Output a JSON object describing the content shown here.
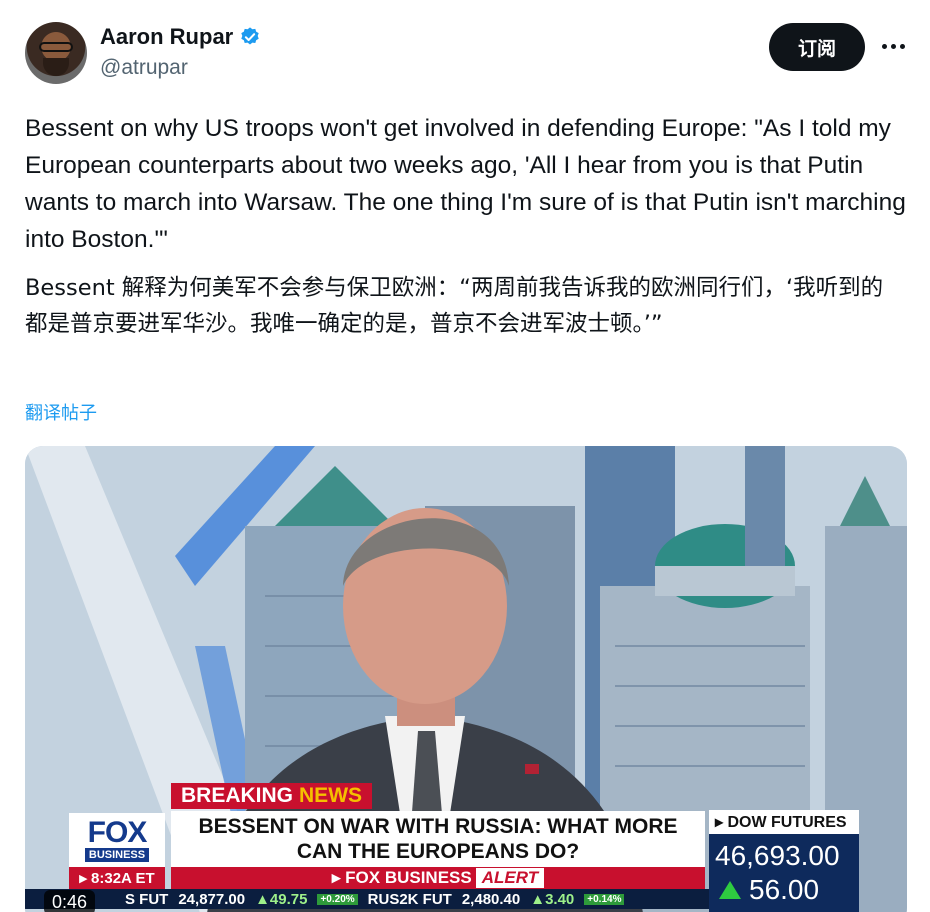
{
  "author": {
    "display_name": "Aaron Rupar",
    "handle": "@atrupar"
  },
  "header": {
    "subscribe_label": "订阅",
    "more_icon": "more-horizontal-icon"
  },
  "tweet": {
    "text_en": "Bessent on why US troops won't get involved in defending Europe: \"As I told my European counterparts about two weeks ago, 'All I hear from you is that Putin wants to march into Warsaw. The one thing I'm sure of is that Putin isn't marching into Boston.'\"",
    "text_zh": "Bessent 解释为何美军不会参与保卫欧洲：“两周前我告诉我的欧洲同行们，‘我听到的都是普京要进军华沙。我唯一确定的是，普京不会进军波士顿。’”",
    "translate_label": "翻译帖子"
  },
  "video": {
    "duration": "0:46",
    "breaking": "BREAKING",
    "news": "NEWS",
    "headline_line1": "BESSENT ON WAR WITH RUSSIA: WHAT MORE",
    "headline_line2": "CAN THE EUROPEANS DO?",
    "network_word": "FOX",
    "network_sub": "BUSINESS",
    "time": "▸ 8:32A ET",
    "alert_prefix": "▸ FOX BUSINESS",
    "alert_word": "ALERT",
    "dow_label": "▸ DOW FUTURES",
    "dow_value": "46,693.00",
    "dow_change": "56.00",
    "ticker": [
      {
        "name": "S FUT",
        "value": "24,877.00",
        "change": "▲49.75",
        "pct": "+0.20%"
      },
      {
        "name": "RUS2K FUT",
        "value": "2,480.40",
        "change": "▲3.40",
        "pct": "+0.14%"
      }
    ],
    "colors": {
      "fox_red": "#c8102e",
      "fox_blue": "#143a8c",
      "x_blue": "#1d9bf0"
    }
  }
}
